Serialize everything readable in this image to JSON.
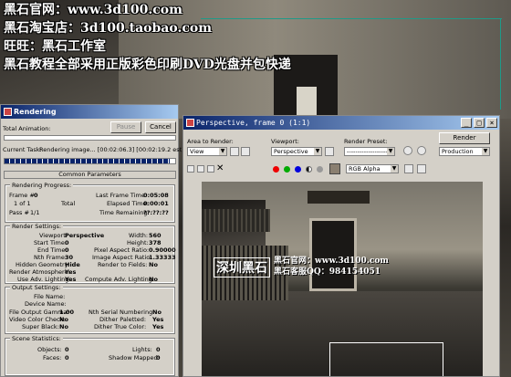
{
  "watermark": {
    "line1": "黑石官网：www.3d100.com",
    "line2": "黑石淘宝店：3d100.taobao.com",
    "line3": "旺旺：黑石工作室",
    "line4": "黑石教程全部采用正版彩色印刷DVD光盘并包快递"
  },
  "rendering": {
    "title": "Rendering",
    "total_animation": "Total Animation:",
    "pause": "Pause",
    "cancel": "Cancel",
    "current_task_label": "Current Task:",
    "current_task_value": "Rendering image... [00:02:06.3] [00:02:19.2 est]",
    "progress": 0.97,
    "common_params": "Common Parameters",
    "rendering_progress": "Rendering Progress:",
    "frame_label": "Frame #",
    "frame_value": "0",
    "of_label": "1 of 1",
    "total_label": "Total",
    "pass_label": "Pass #",
    "pass_value": "1/1",
    "last_frame_time_label": "Last Frame Time:",
    "last_frame_time": "0:05:08",
    "elapsed_time_label": "Elapsed Time:",
    "elapsed_time": "0:00:01",
    "time_remaining_label": "Time Remaining:",
    "time_remaining": "??:??:??",
    "render_settings": "Render Settings:",
    "viewport_label": "Viewport:",
    "viewport": "Perspective",
    "start_time_label": "Start Time:",
    "start_time": "0",
    "end_time_label": "End Time:",
    "end_time": "0",
    "nth_frame_label": "Nth Frame:",
    "nth_frame": "30",
    "hidden_geometry_label": "Hidden Geometry:",
    "hidden_geometry": "Hide",
    "render_atmosphere_label": "Render Atmosphere:",
    "render_atmosphere": "Yes",
    "use_adv_lighting_label": "Use Adv. Lighting:",
    "use_adv_lighting": "Yes",
    "width_label": "Width:",
    "width": "560",
    "height_label": "Height:",
    "height": "378",
    "pixel_aspect_label": "Pixel Aspect Ratio:",
    "pixel_aspect": "0.90000",
    "image_aspect_label": "Image Aspect Ratio:",
    "image_aspect": "1.33333",
    "render_fields_label": "Render to Fields:",
    "render_fields": "No",
    "compute_adv_label": "Compute Adv. Lighting:",
    "compute_adv": "No",
    "output_settings": "Output Settings:",
    "file_name_label": "File Name:",
    "device_name_label": "Device Name:",
    "file_output_gamma_label": "File Output Gamma:",
    "file_output_gamma": "1.00",
    "video_color_check_label": "Video Color Check:",
    "video_color_check": "No",
    "super_black_label": "Super Black:",
    "super_black": "No",
    "nth_serial_label": "Nth Serial Numbering:",
    "nth_serial": "No",
    "dither_paletted_label": "Dither Paletted:",
    "dither_paletted": "Yes",
    "dither_true_label": "Dither True Color:",
    "dither_true": "Yes",
    "scene_statistics": "Scene Statistics:",
    "objects_label": "Objects:",
    "objects": "0",
    "faces_label": "Faces:",
    "faces": "0",
    "lights_label": "Lights:",
    "lights": "0",
    "shadow_mapped_label": "Shadow Mapped:",
    "shadow_mapped": "0"
  },
  "perspective": {
    "title": "Perspective, frame 0 (1:1)",
    "area_label": "Area to Render:",
    "area_value": "View",
    "viewport_label": "Viewport:",
    "viewport_value": "Perspective",
    "preset_label": "Render Preset:",
    "preset_value": "-------------------",
    "render_button": "Render",
    "production_value": "Production",
    "channel_value": "RGB Alpha"
  },
  "overlay": {
    "site": "黑石官网：www.3d100.com",
    "brand": "深圳黑石",
    "qq_label": "黑石客服QQ：",
    "qq": "984154051"
  }
}
